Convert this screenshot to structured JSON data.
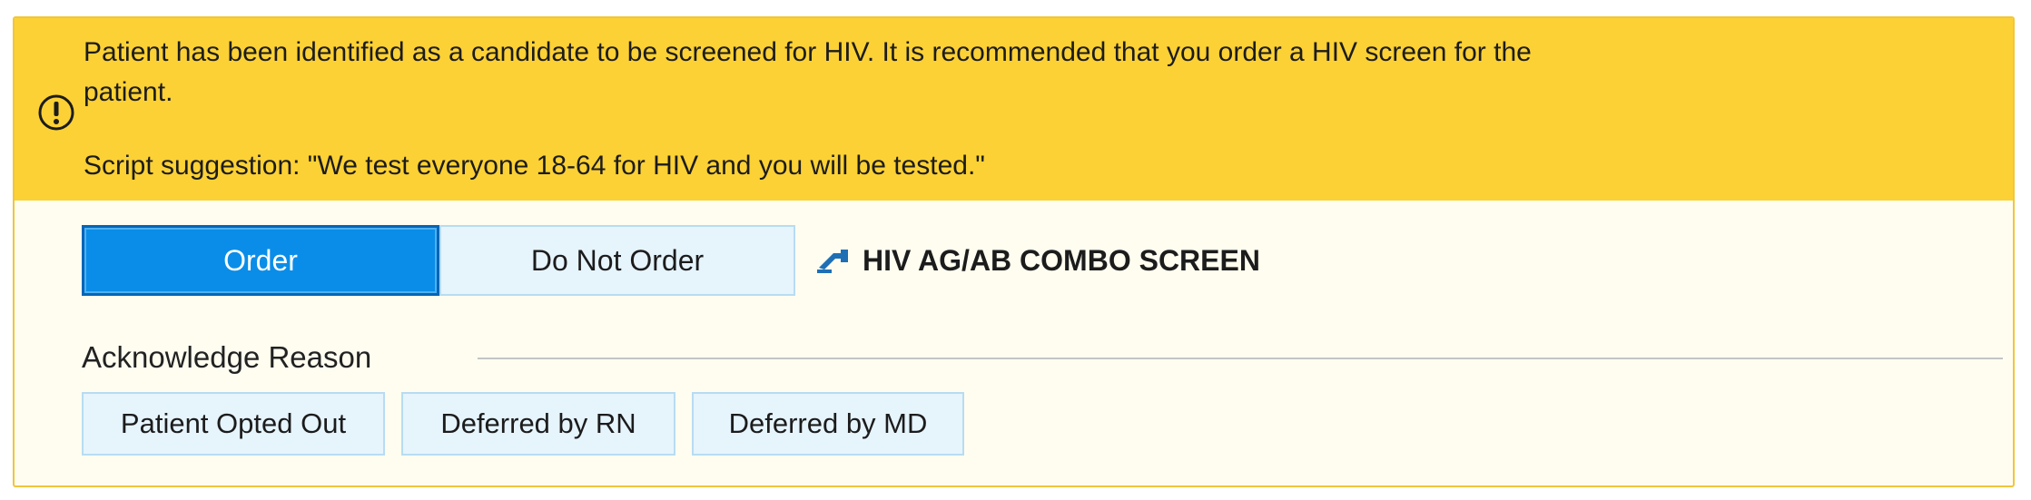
{
  "alert": {
    "message_line1": "Patient has been identified as a candidate to be screened for HIV. It is recommended that you order a HIV screen for the",
    "message_line2": "patient.",
    "script_suggestion": "Script suggestion: \"We test everyone 18-64 for HIV and you will be tested.\"",
    "icon": "alert-circle-exclamation-icon",
    "header_color": "#fcd135"
  },
  "actions": {
    "order_label": "Order",
    "do_not_order_label": "Do Not Order",
    "selected": "Order",
    "order_name": "HIV AG/AB COMBO SCREEN",
    "order_icon": "order-lab-icon",
    "accent_color": "#0a8de8"
  },
  "acknowledge": {
    "title": "Acknowledge Reason",
    "reasons": [
      {
        "label": "Patient Opted Out"
      },
      {
        "label": "Deferred by RN"
      },
      {
        "label": "Deferred by MD"
      }
    ]
  }
}
